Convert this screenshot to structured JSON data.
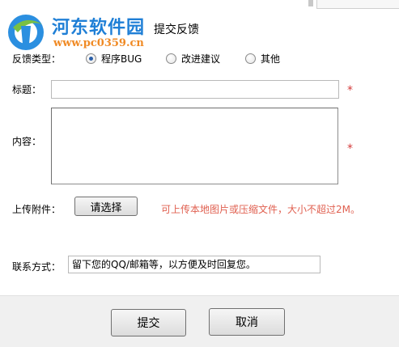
{
  "watermark": {
    "site_name": "河东软件园",
    "url": "www.pc0359.cn"
  },
  "dialog": {
    "title": "提交反馈"
  },
  "feedback_type": {
    "label": "反馈类型：",
    "options": [
      {
        "label": "程序BUG",
        "selected": true
      },
      {
        "label": "改进建议",
        "selected": false
      },
      {
        "label": "其他",
        "selected": false
      }
    ]
  },
  "title_field": {
    "label": "标题：",
    "value": "",
    "required_mark": "*"
  },
  "content_field": {
    "label": "内容：",
    "value": "",
    "required_mark": "*"
  },
  "attachment": {
    "label": "上传附件：",
    "button_label": "请选择",
    "hint": "可上传本地图片或压缩文件，大小不超过2M。"
  },
  "contact": {
    "label": "联系方式：",
    "value": "留下您的QQ/邮箱等，以方便及时回复您。"
  },
  "actions": {
    "submit_label": "提交",
    "cancel_label": "取消"
  },
  "colors": {
    "watermark_blue": "#1f7fd6",
    "watermark_orange": "#f08a24",
    "required_red": "#d43a3a",
    "hint_red": "#e06050",
    "footer_bg": "#f0f0f0"
  }
}
